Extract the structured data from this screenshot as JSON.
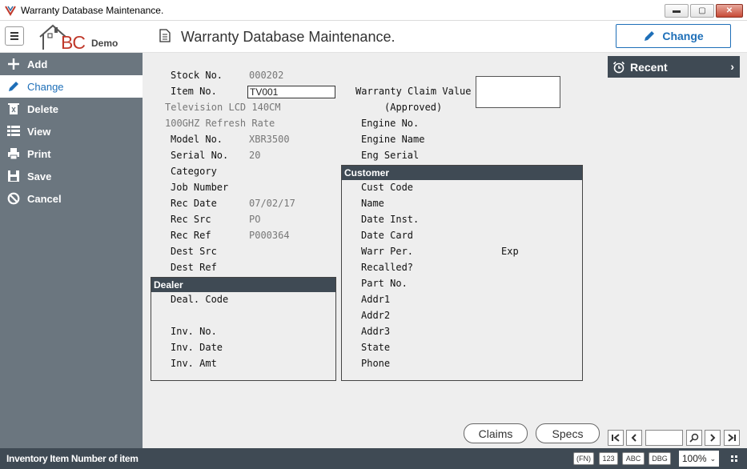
{
  "window": {
    "title": "Warranty Database Maintenance.",
    "controls": {
      "minimize": "▬",
      "maximize": "▢",
      "close": "✕"
    }
  },
  "header": {
    "logo_text": "BC",
    "logo_subtext": "Demo",
    "page_title": "Warranty Database Maintenance.",
    "mode_button": "Change"
  },
  "sidebar": {
    "items": [
      {
        "label": "Add",
        "icon": "plus-icon"
      },
      {
        "label": "Change",
        "icon": "pencil-icon",
        "active": true
      },
      {
        "label": "Delete",
        "icon": "trash-icon"
      },
      {
        "label": "View",
        "icon": "list-icon"
      },
      {
        "label": "Print",
        "icon": "printer-icon"
      },
      {
        "label": "Save",
        "icon": "floppy-icon"
      },
      {
        "label": "Cancel",
        "icon": "cancel-icon"
      }
    ]
  },
  "form": {
    "stock_no": {
      "label": "Stock No.",
      "value": "000202"
    },
    "item_no": {
      "label": "Item No.",
      "value": "TV001"
    },
    "item_desc1": "Television LCD 140CM",
    "item_desc2": "100GHZ Refresh Rate",
    "model_no": {
      "label": "Model No.",
      "value": "XBR3500"
    },
    "serial_no": {
      "label": "Serial No.",
      "value": "20"
    },
    "category": {
      "label": "Category",
      "value": ""
    },
    "job_number": {
      "label": "Job Number",
      "value": ""
    },
    "rec_date": {
      "label": "Rec Date",
      "value": "07/02/17"
    },
    "rec_src": {
      "label": "Rec Src",
      "value": "PO"
    },
    "rec_ref": {
      "label": "Rec Ref",
      "value": "P000364"
    },
    "dest_src": {
      "label": "Dest Src",
      "value": ""
    },
    "dest_ref": {
      "label": "Dest Ref",
      "value": ""
    },
    "warranty_claim_value": {
      "label": "Warranty Claim Value",
      "sublabel": "(Approved)",
      "value": ""
    },
    "engine_no": {
      "label": "Engine No.",
      "value": ""
    },
    "engine_name": {
      "label": "Engine Name",
      "value": ""
    },
    "eng_serial": {
      "label": "Eng Serial",
      "value": ""
    }
  },
  "customer": {
    "title": "Customer",
    "fields": [
      "Cust Code",
      "Name",
      "Date Inst.",
      "Date Card",
      "Warr Per.",
      "Recalled?",
      "Part No.",
      "Addr1",
      "Addr2",
      "Addr3",
      "State",
      "Phone"
    ],
    "exp_label": "Exp"
  },
  "dealer": {
    "title": "Dealer",
    "deal_code": "Deal. Code",
    "inv_no": "Inv. No.",
    "inv_date": "Inv. Date",
    "inv_amt": "Inv. Amt"
  },
  "recent": {
    "label": "Recent"
  },
  "buttons": {
    "claims": "Claims",
    "specs": "Specs"
  },
  "record_nav": {
    "first": "|<",
    "prev": "<",
    "next": ">",
    "last": ">|",
    "search_icon": "magnifier-icon"
  },
  "status": {
    "text": "Inventory Item Number of item",
    "chips": [
      "(FN)",
      "123",
      "ABC",
      "DBG"
    ],
    "zoom": "100%"
  },
  "colors": {
    "accent": "#1e6fb8",
    "sidebar_bg": "#6b767f",
    "section_header": "#3f4a54",
    "main_bg": "#eeeeee"
  }
}
